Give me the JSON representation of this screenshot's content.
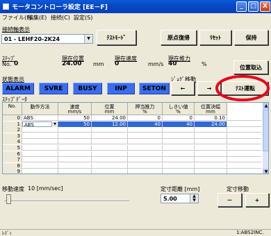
{
  "window": {
    "title": "モータコントローラ設定 [EE－F]",
    "controls": {
      "minimize": "_",
      "maximize": "□",
      "close": "X"
    }
  },
  "menu": [
    "ファイル(F)",
    "編集(E)",
    "接続(C)",
    "設定(S)"
  ],
  "axis": {
    "label": "接続軸表示",
    "selected": "01 - LEHF20-2K24"
  },
  "toolbar": {
    "test_mode": "ﾃｽﾄﾓｰﾄﾞ",
    "return_origin": "原点復帰",
    "reset": "ﾘｾｯﾄ",
    "save": "保持"
  },
  "readout": {
    "step_label": "ｽﾃｯﾌﾟ",
    "step_no_label": "No.",
    "step_no": "0",
    "position_label": "現在位置",
    "position": "24.00",
    "position_unit": "mm",
    "speed_label": "現在速度",
    "speed": "0",
    "speed_unit": "mm/s",
    "thrust_label": "現在推力",
    "thrust": "40",
    "thrust_unit": "%",
    "take_position": "位置取込"
  },
  "status": {
    "label": "状態表示",
    "buttons": [
      "ALARM",
      "SVRE",
      "BUSY",
      "INP",
      "SETON"
    ]
  },
  "jog": {
    "label": "ｼﾞｮｸﾞ移動",
    "left": "←",
    "right": "→",
    "test_run": "ﾃｽﾄ運転"
  },
  "step_table": {
    "label": "ｽﾃｯﾌﾟﾃﾞｰﾀ",
    "headers": [
      "No.",
      "動作方法",
      "速度",
      "位置",
      "押当推力",
      "しきい値",
      "位置決幅"
    ],
    "units": [
      "",
      "",
      "mm/s",
      "mm",
      "%",
      "%",
      "mm"
    ],
    "rows": [
      [
        "0",
        "ABS",
        "50",
        "24.00",
        "0",
        "0",
        "0.10"
      ],
      [
        "1",
        "ABS",
        "50",
        "12.00",
        "40",
        "40",
        "24.00"
      ],
      [
        "2",
        "",
        "",
        "",
        "",
        "",
        ""
      ],
      [
        "3",
        "",
        "",
        "",
        "",
        "",
        ""
      ],
      [
        "4",
        "",
        "",
        "",
        "",
        "",
        ""
      ],
      [
        "5",
        "",
        "",
        "",
        "",
        "",
        ""
      ],
      [
        "6",
        "",
        "",
        "",
        "",
        "",
        ""
      ],
      [
        "7",
        "",
        "",
        "",
        "",
        "",
        ""
      ],
      [
        "8",
        "",
        "",
        "",
        "",
        "",
        ""
      ],
      [
        "9",
        "",
        "",
        "",
        "",
        "",
        ""
      ]
    ]
  },
  "move": {
    "speed_label": "移動速度",
    "speed_value": "10 [mm/sec]",
    "distance_label": "定寸距離 [mm]",
    "distance_value": "5.00",
    "fixed_move_label": "定寸移動",
    "minus": "－",
    "plus": "+"
  },
  "statusbar": {
    "left": "ﾚﾃﾞｨ",
    "right": "1:ABS2INC."
  },
  "colors": {
    "highlight_ring": "#e8001c",
    "status_blue": "#3a6df0",
    "title_blue": "#0a5ad7"
  }
}
